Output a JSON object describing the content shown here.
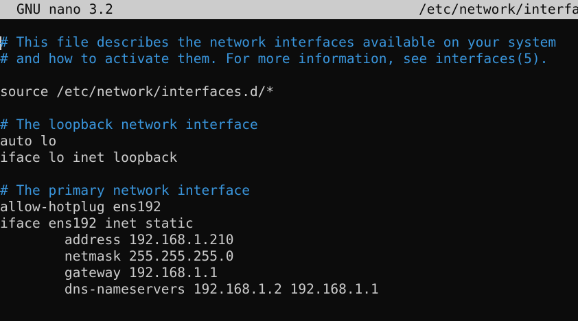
{
  "titlebar": {
    "app": "GNU nano 3.2",
    "filename": "/etc/network/interfa"
  },
  "colors": {
    "background": "#0c0c0c",
    "foreground": "#cccccc",
    "comment": "#3a96dd",
    "titlebar_bg": "#cccccc",
    "titlebar_fg": "#0c0c0c"
  },
  "lines": [
    "# This file describes the network interfaces available on your system",
    "# and how to activate them. For more information, see interfaces(5).",
    "",
    "source /etc/network/interfaces.d/*",
    "",
    "# The loopback network interface",
    "auto lo",
    "iface lo inet loopback",
    "",
    "# The primary network interface",
    "allow-hotplug ens192",
    "iface ens192 inet static",
    "        address 192.168.1.210",
    "        netmask 255.255.255.0",
    "        gateway 192.168.1.1",
    "        dns-nameservers 192.168.1.2 192.168.1.1"
  ]
}
